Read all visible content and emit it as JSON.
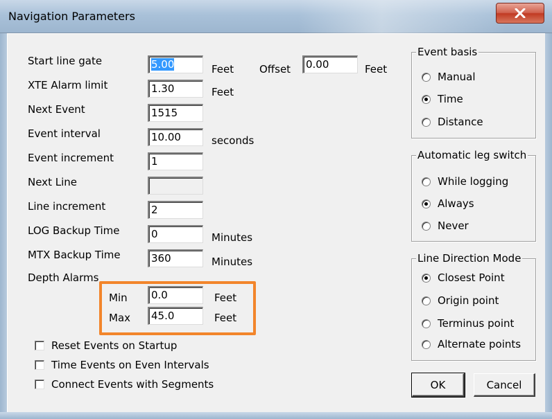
{
  "window": {
    "title": "Navigation Parameters",
    "close_symbol": "X"
  },
  "fields": [
    {
      "id": "start-line-gate",
      "label": "Start line gate",
      "value": "5.00",
      "selected": true,
      "unit": "Feet"
    },
    {
      "id": "xte-alarm-limit",
      "label": "XTE Alarm limit",
      "value": "1.30",
      "unit": "Feet"
    },
    {
      "id": "next-event",
      "label": "Next Event",
      "value": "1515",
      "unit": ""
    },
    {
      "id": "event-interval",
      "label": "Event interval",
      "value": "10.00",
      "unit": "seconds"
    },
    {
      "id": "event-increment",
      "label": "Event increment",
      "value": "1",
      "unit": ""
    },
    {
      "id": "next-line",
      "label": "Next Line",
      "value": "",
      "unit": "",
      "disabled": true
    },
    {
      "id": "line-increment",
      "label": "Line increment",
      "value": "2",
      "unit": ""
    },
    {
      "id": "log-backup-time",
      "label": "LOG Backup Time",
      "value": "0",
      "unit": "Minutes"
    },
    {
      "id": "mtx-backup-time",
      "label": "MTX Backup Time",
      "value": "360",
      "unit": "Minutes"
    }
  ],
  "offset": {
    "label": "Offset",
    "value": "0.00",
    "unit": "Feet"
  },
  "depth_alarms": {
    "label": "Depth Alarms",
    "min": {
      "label": "Min",
      "value": "0.0",
      "unit": "Feet"
    },
    "max": {
      "label": "Max",
      "value": "45.0",
      "unit": "Feet"
    },
    "highlight_color": "#f2852b"
  },
  "checkboxes": [
    {
      "label": "Reset Events on Startup",
      "checked": false
    },
    {
      "label": "Time Events on Even Intervals",
      "checked": false
    },
    {
      "label": "Connect Events with Segments",
      "checked": false
    }
  ],
  "event_basis": {
    "title": "Event basis",
    "options": [
      {
        "label": "Manual",
        "selected": false
      },
      {
        "label": "Time",
        "selected": true
      },
      {
        "label": "Distance",
        "selected": false
      }
    ]
  },
  "automatic_leg_switch": {
    "title": "Automatic leg switch",
    "options": [
      {
        "label": "While logging",
        "selected": false
      },
      {
        "label": "Always",
        "selected": true
      },
      {
        "label": "Never",
        "selected": false
      }
    ]
  },
  "line_direction_mode": {
    "title": "Line Direction Mode",
    "options": [
      {
        "label": "Closest Point",
        "selected": true
      },
      {
        "label": "Origin point",
        "selected": false
      },
      {
        "label": "Terminus point",
        "selected": false
      },
      {
        "label": "Alternate points",
        "selected": false
      }
    ]
  },
  "buttons": {
    "ok": "OK",
    "cancel": "Cancel"
  }
}
